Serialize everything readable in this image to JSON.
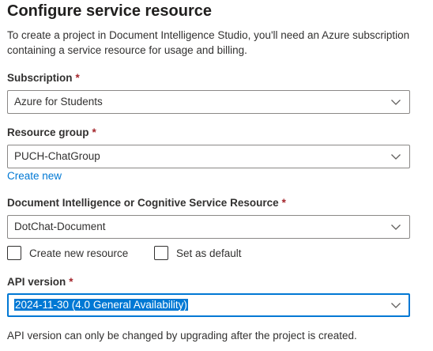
{
  "title": "Configure service resource",
  "description": "To create a project in Document Intelligence Studio, you'll need an Azure subscription containing a service resource for usage and billing.",
  "required_marker": "*",
  "subscription": {
    "label": "Subscription",
    "value": "Azure for Students"
  },
  "resource_group": {
    "label": "Resource group",
    "value": "PUCH-ChatGroup",
    "create_new_link": "Create new"
  },
  "service_resource": {
    "label": "Document Intelligence or Cognitive Service Resource",
    "value": "DotChat-Document",
    "create_new_checkbox": "Create new resource",
    "set_default_checkbox": "Set as default"
  },
  "api_version": {
    "label": "API version",
    "value": "2024-11-30 (4.0 General Availability)",
    "note": "API version can only be changed by upgrading after the project is created."
  },
  "colors": {
    "accent": "#0078d4",
    "required": "#a4262c",
    "border": "#8a8886"
  }
}
